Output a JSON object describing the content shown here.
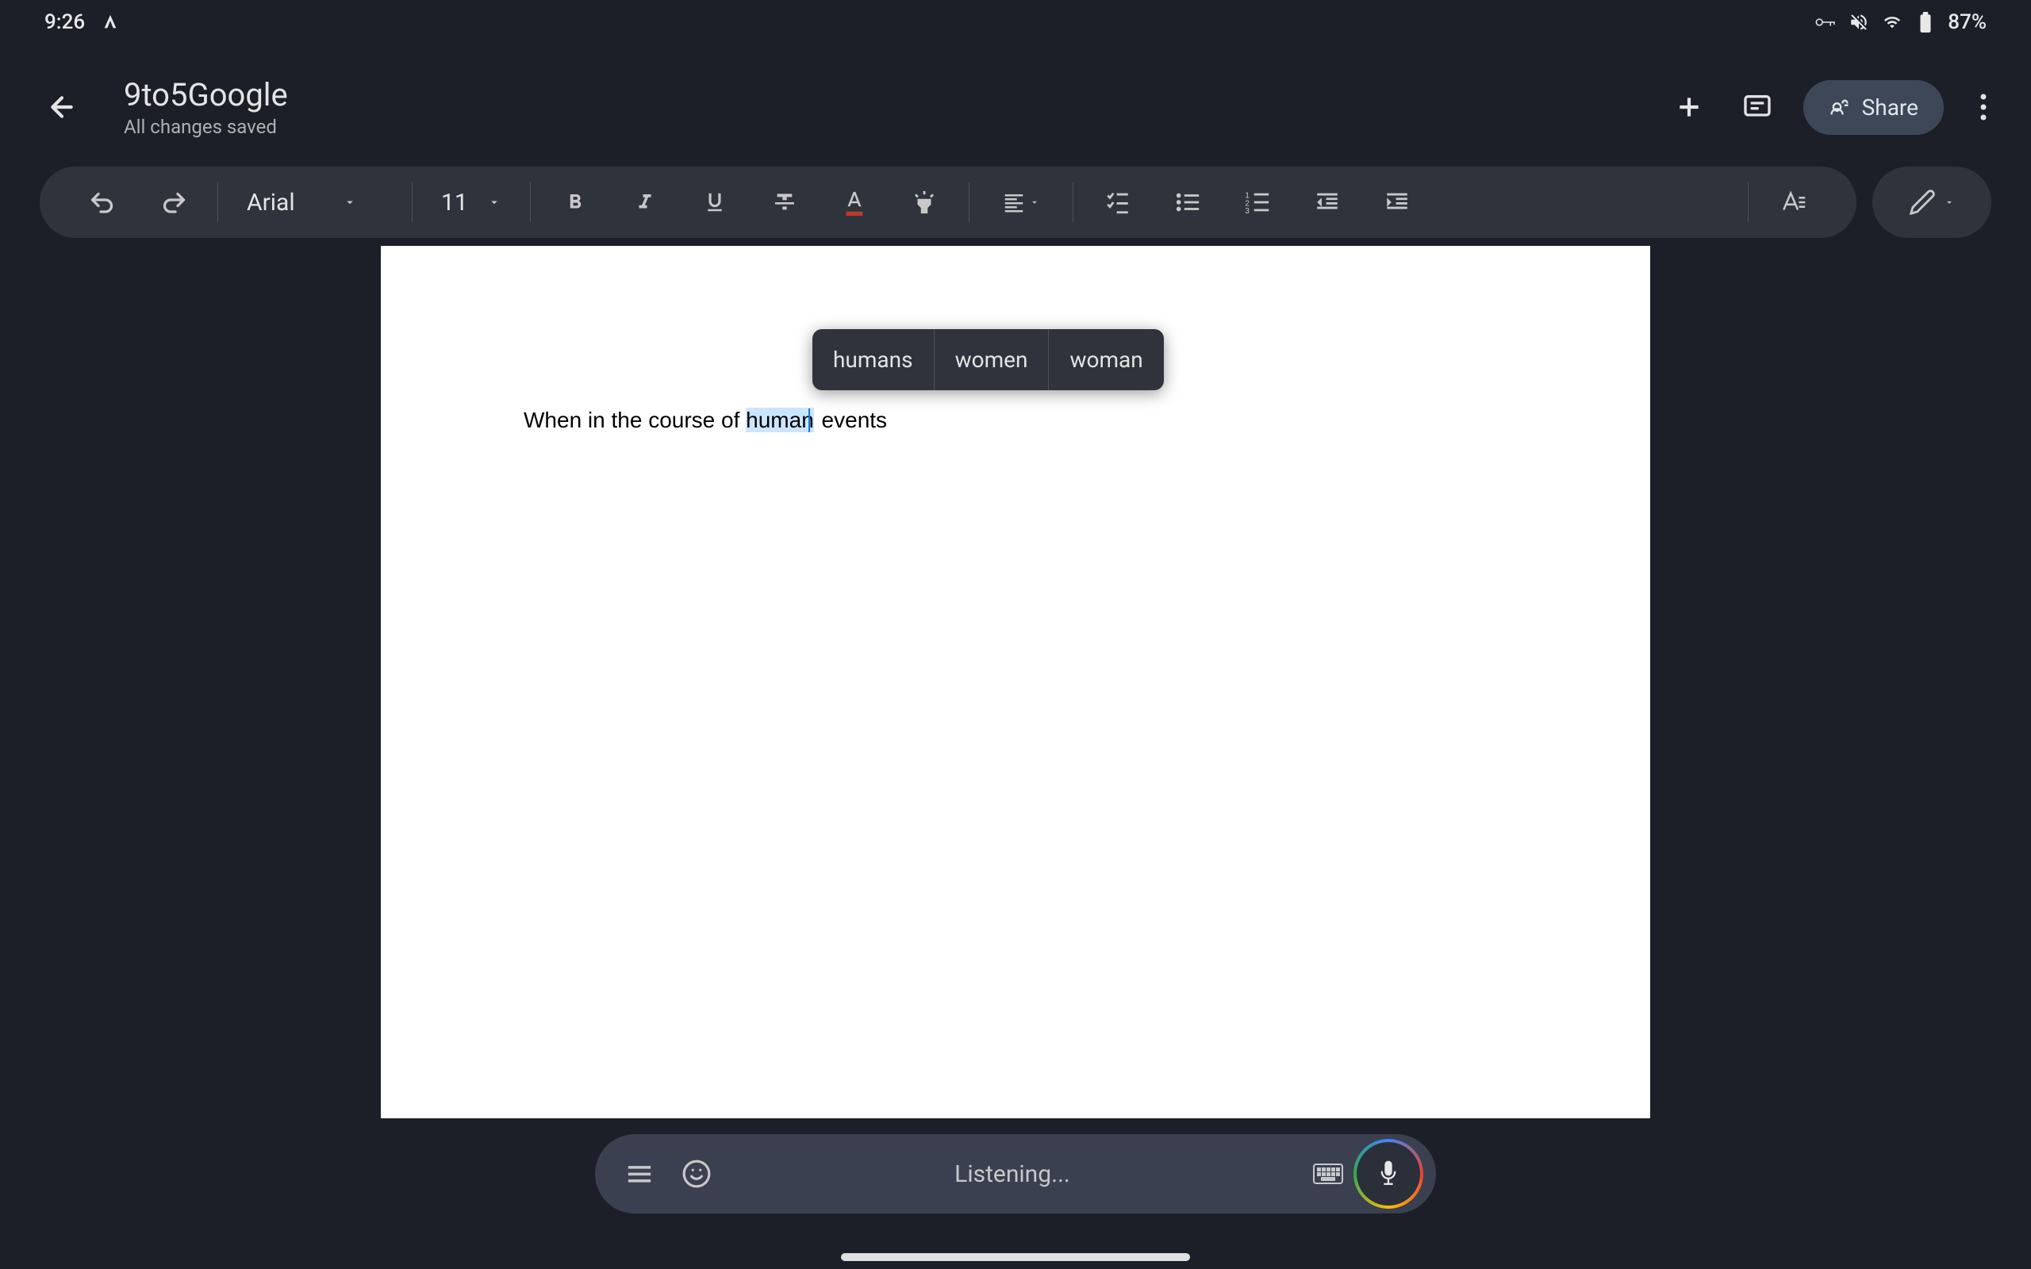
{
  "status": {
    "time": "9:26",
    "battery_pct": "87%"
  },
  "header": {
    "doc_title": "9to5Google",
    "save_status": "All changes saved",
    "share_label": "Share"
  },
  "toolbar": {
    "font_name": "Arial",
    "font_size": "11"
  },
  "document": {
    "text_before": "When in the course of ",
    "text_highlighted": "human",
    "text_after": " events"
  },
  "suggestions": {
    "options": [
      "humans",
      "women",
      "woman"
    ]
  },
  "voice": {
    "status": "Listening..."
  }
}
